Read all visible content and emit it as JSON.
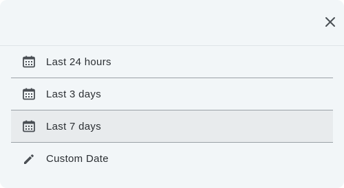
{
  "dialog": {
    "close_icon": "close-icon",
    "options": [
      {
        "label": "Last 24 hours",
        "icon": "calendar-icon",
        "selected": false
      },
      {
        "label": "Last 3 days",
        "icon": "calendar-icon",
        "selected": false
      },
      {
        "label": "Last 7 days",
        "icon": "calendar-icon",
        "selected": true
      },
      {
        "label": "Custom Date",
        "icon": "pencil-icon",
        "selected": false
      }
    ]
  },
  "colors": {
    "background": "#f2f6f8",
    "selected_background": "#e8ebed",
    "divider": "#9aa0a6",
    "icon": "#4a4f54",
    "text": "#2b2f33"
  }
}
